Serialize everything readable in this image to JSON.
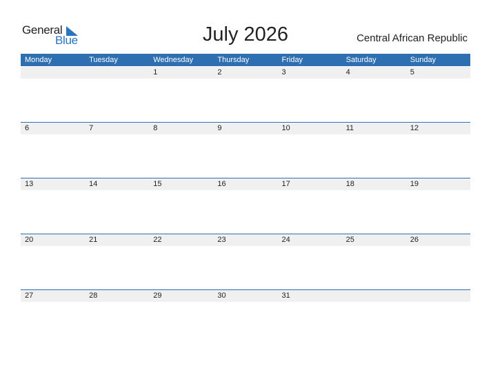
{
  "logo": {
    "line1": "General",
    "line2": "Blue"
  },
  "title": "July 2026",
  "country": "Central African Republic",
  "colors": {
    "accent": "#2e6fb2",
    "strip": "#f0f0f0"
  },
  "weekdays": [
    "Monday",
    "Tuesday",
    "Wednesday",
    "Thursday",
    "Friday",
    "Saturday",
    "Sunday"
  ],
  "weeks": [
    [
      "",
      "",
      "1",
      "2",
      "3",
      "4",
      "5"
    ],
    [
      "6",
      "7",
      "8",
      "9",
      "10",
      "11",
      "12"
    ],
    [
      "13",
      "14",
      "15",
      "16",
      "17",
      "18",
      "19"
    ],
    [
      "20",
      "21",
      "22",
      "23",
      "24",
      "25",
      "26"
    ],
    [
      "27",
      "28",
      "29",
      "30",
      "31",
      "",
      ""
    ]
  ]
}
